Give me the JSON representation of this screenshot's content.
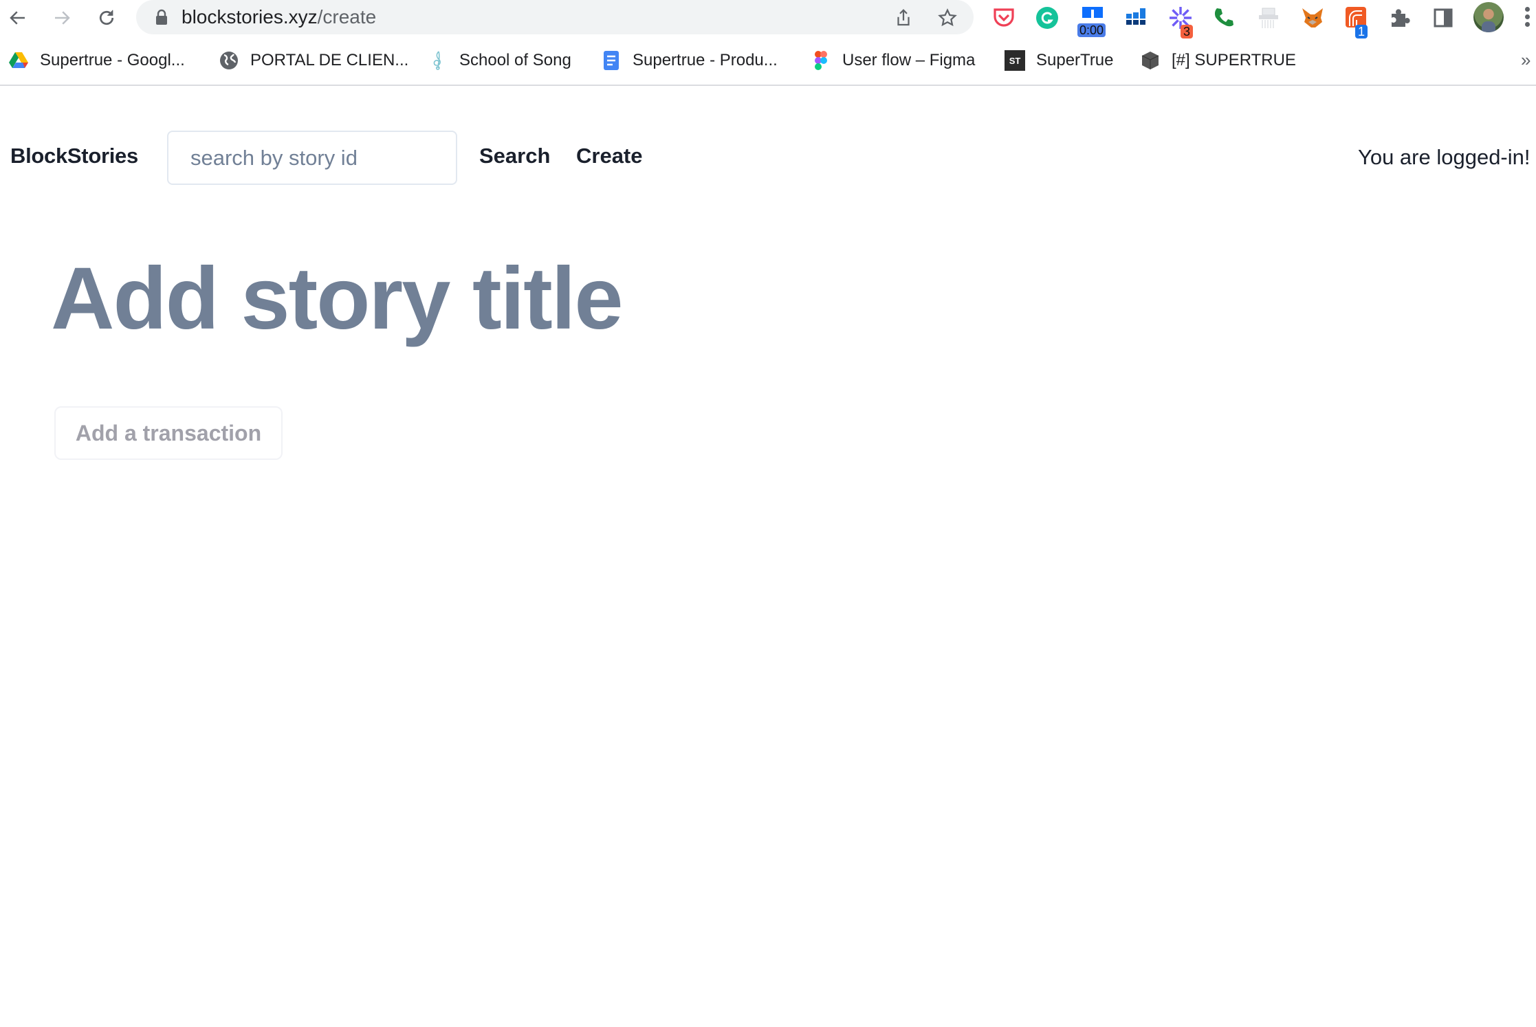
{
  "browser": {
    "url_host": "blockstories.xyz",
    "url_path": "/create",
    "extensions": {
      "timer_badge": "0:00",
      "asterisk_badge": "3",
      "rss_badge": "1"
    },
    "bookmarks": [
      {
        "label": "Supertrue - Googl...",
        "icon": "google-drive-icon"
      },
      {
        "label": "PORTAL DE CLIEN...",
        "icon": "globe-icon"
      },
      {
        "label": "School of Song",
        "icon": "treble-clef-icon"
      },
      {
        "label": "Supertrue - Produ...",
        "icon": "google-docs-icon"
      },
      {
        "label": "User flow – Figma",
        "icon": "figma-icon"
      },
      {
        "label": "SuperTrue",
        "icon": "supertrue-icon"
      },
      {
        "label": "[#] SUPERTRUE",
        "icon": "cube-icon"
      }
    ],
    "overflow_label": "»"
  },
  "header": {
    "logo": "BlockStories",
    "search_placeholder": "search by story id",
    "search_value": "",
    "nav": [
      {
        "label": "Search"
      },
      {
        "label": "Create"
      }
    ],
    "login_status": "You are logged-in!"
  },
  "main": {
    "title_placeholder": "Add story title",
    "add_transaction_label": "Add a transaction"
  },
  "colors": {
    "text_dark": "#1a202c",
    "title_slate": "#718096",
    "button_text": "#a1a1aa",
    "input_border": "#e2e8f0"
  }
}
